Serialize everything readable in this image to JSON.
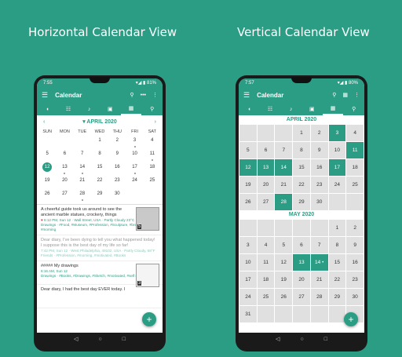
{
  "captions": {
    "left": "Horizontal Calendar View",
    "right": "Vertical Calendar View"
  },
  "left_phone": {
    "status": {
      "time": "7:55",
      "battery": "81%"
    },
    "appbar": {
      "title": "Calendar",
      "menu_icon": "menu-icon",
      "actions": [
        "search-icon",
        "more-horizontal-icon",
        "more-vertical-icon"
      ]
    },
    "tabs": [
      "tag-icon",
      "list-icon",
      "music-icon",
      "image-icon",
      "calendar-icon",
      "location-icon"
    ],
    "active_tab": 4,
    "month": {
      "title": "APRIL 2020",
      "prev": "‹",
      "next": "›",
      "day_headers": [
        "SUN",
        "MON",
        "TUE",
        "WED",
        "THU",
        "FRI",
        "SAT"
      ],
      "days": [
        "",
        "",
        "",
        "1",
        "2",
        "3",
        "4",
        "5",
        "6",
        "7",
        "8",
        "9",
        "10",
        "11",
        "12",
        "13",
        "14",
        "15",
        "16",
        "17",
        "18",
        "19",
        "20",
        "21",
        "22",
        "23",
        "24",
        "25",
        "26",
        "27",
        "28",
        "29",
        "30",
        "",
        ""
      ],
      "today": "12",
      "dotted": [
        "3",
        "11",
        "12",
        "13",
        "14",
        "17",
        "28"
      ]
    },
    "entries": [
      {
        "text": "A cheerful guide took us around to see the ancient marble statues, crockery, things",
        "meta": "6:12 PM, Sun 12 · Wall Street, USA · Partly Cloudy 23°C",
        "tags": "Drawings · #Food, #Museum, #Profession, #Sculpture, #breakfast, #morning",
        "photo_count": "5"
      },
      {
        "text": "Dear diary, I've been dying to tell you what happened today! I suppose this is the best day of my life so far!",
        "meta": "7:42 PM, Sun 12 · West Philadelphia, 49102, USA · Partly Cloudy, 68°F",
        "tags": "Friends · #Profession, #morning, #motivated, #Books"
      },
      {
        "text": "##### My drawings",
        "meta": "6:16 AM, Sun 12",
        "tags": "Drawings · #Books, #Drawings, #Sketch, #motivated, #self made, #Fat",
        "photo_count": "3"
      },
      {
        "text": "Dear diary, I had the best day EVER today. I"
      }
    ],
    "fab_label": "+"
  },
  "right_phone": {
    "status": {
      "time": "7:57",
      "battery": "80%"
    },
    "appbar": {
      "title": "Calendar",
      "menu_icon": "menu-icon",
      "actions": [
        "search-icon",
        "calendar-icon",
        "more-vertical-icon"
      ]
    },
    "tabs": [
      "tag-icon",
      "list-icon",
      "music-icon",
      "image-icon",
      "calendar-icon",
      "location-icon"
    ],
    "active_tab": 4,
    "months": [
      {
        "title": "APRIL 2020",
        "days": [
          "",
          "",
          "",
          "1",
          "2",
          "3",
          "4",
          "5",
          "6",
          "7",
          "8",
          "9",
          "10",
          "11",
          "12",
          "13",
          "14",
          "15",
          "16",
          "17",
          "18",
          "19",
          "20",
          "21",
          "22",
          "23",
          "24",
          "25",
          "26",
          "27",
          "28",
          "29",
          "30",
          "",
          ""
        ],
        "highlighted": [
          "3",
          "11",
          "12",
          "13",
          "14",
          "17",
          "28"
        ]
      },
      {
        "title": "MAY 2020",
        "days": [
          "",
          "",
          "",
          "",
          "",
          "1",
          "2",
          "3",
          "4",
          "5",
          "6",
          "7",
          "8",
          "9",
          "10",
          "11",
          "12",
          "13",
          "14 •",
          "15",
          "16",
          "17",
          "18",
          "19",
          "20",
          "21",
          "22",
          "23",
          "24",
          "25",
          "26",
          "27",
          "28",
          "29",
          "30",
          "31",
          "",
          "",
          "",
          "",
          "",
          ""
        ],
        "highlighted": [
          "13",
          "14 •"
        ]
      }
    ],
    "fab_label": "+"
  },
  "nav": {
    "back": "◁",
    "home": "○",
    "recents": "□"
  },
  "colors": {
    "brand": "#2a9d84",
    "cell": "#e0e0e0"
  }
}
